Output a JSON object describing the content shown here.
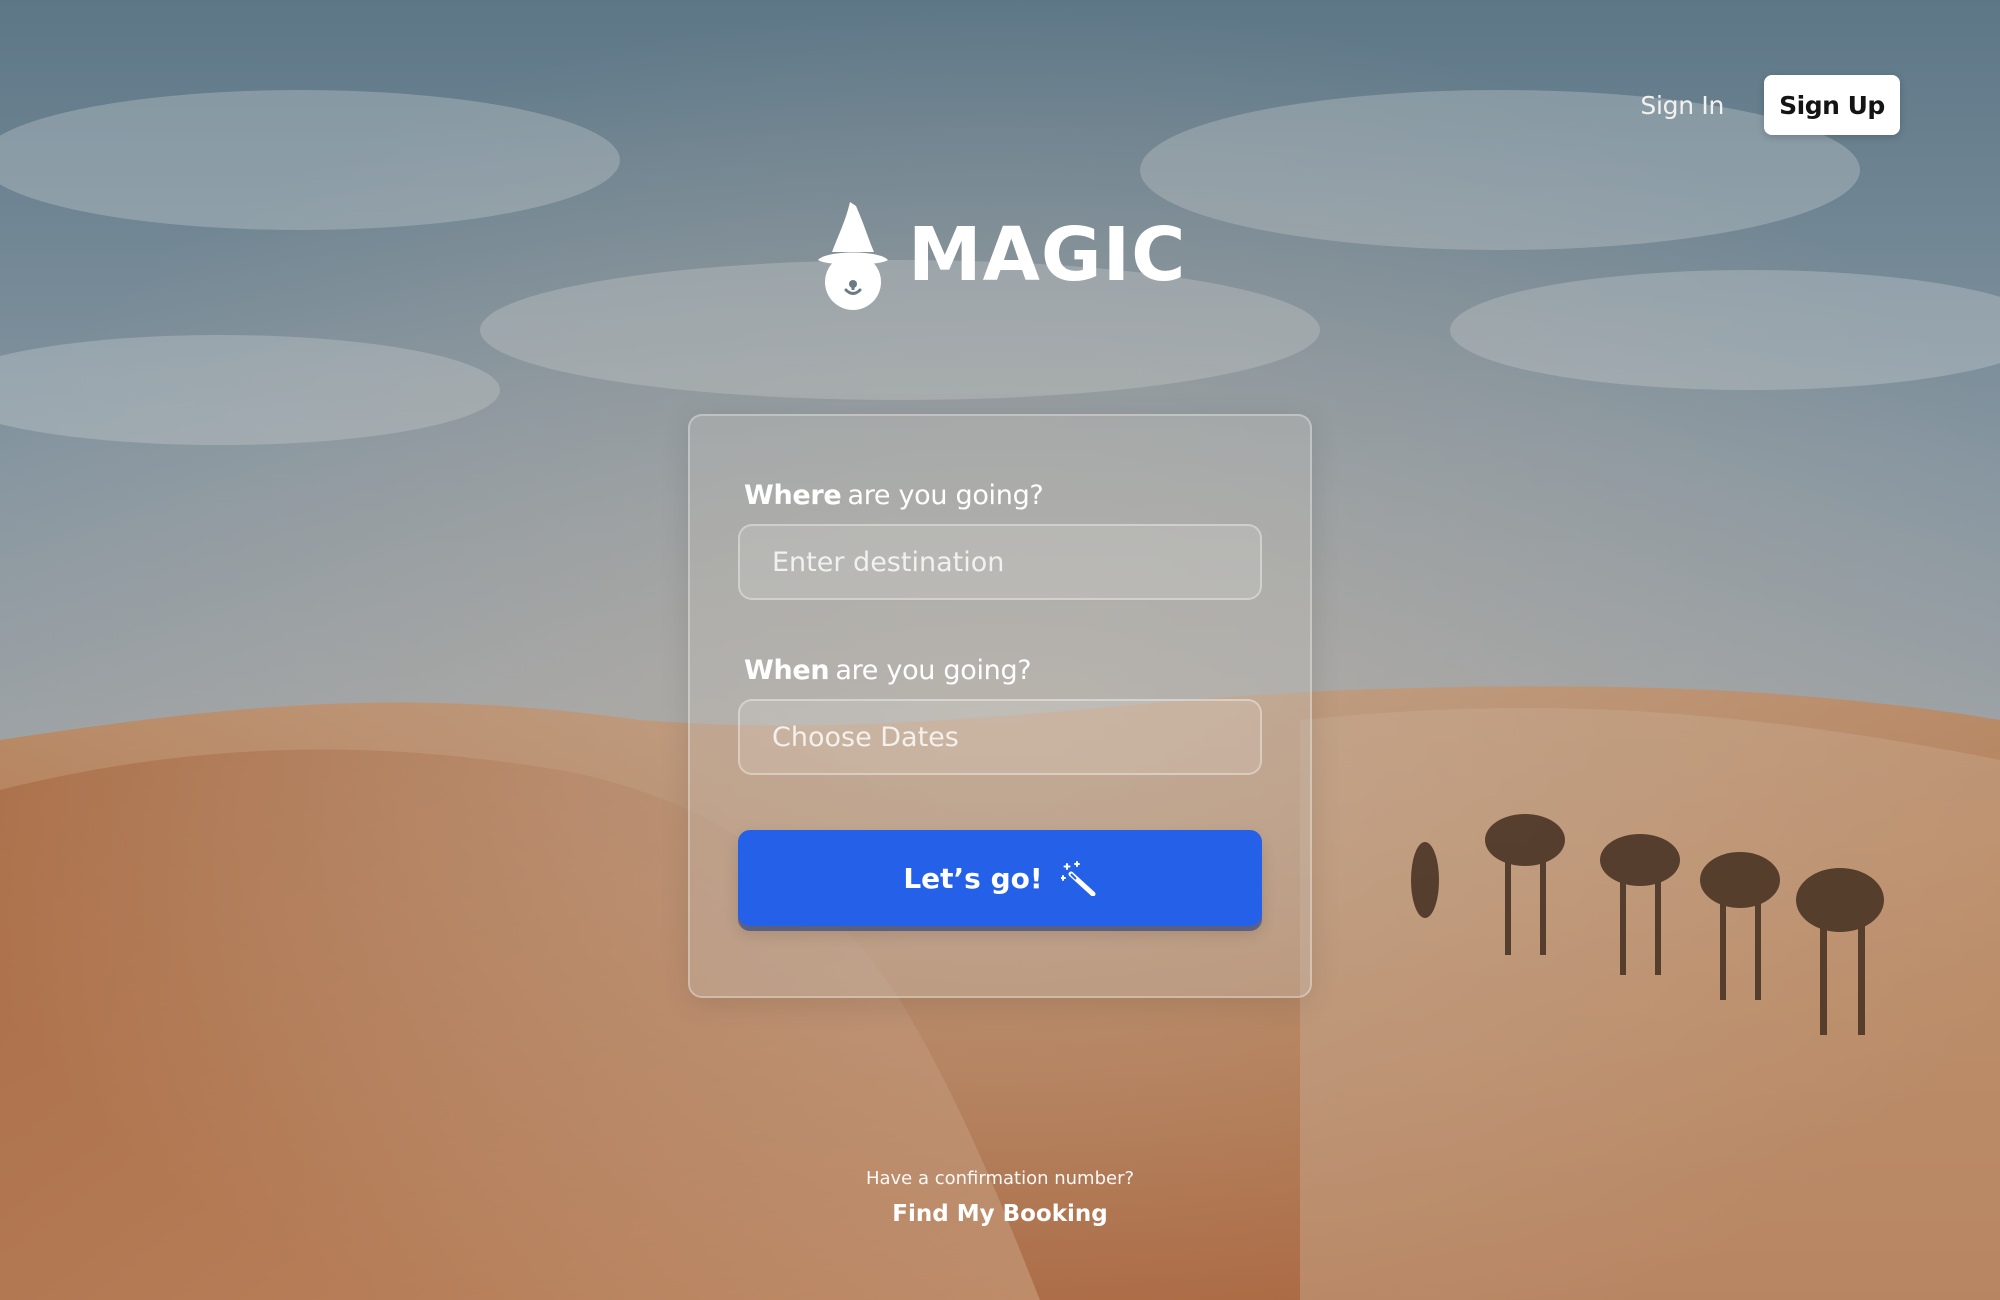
{
  "nav": {
    "sign_in": "Sign In",
    "sign_up": "Sign Up"
  },
  "brand": {
    "name": "MAGIC",
    "logo_icon": "wizard-hat-mascot-icon"
  },
  "form": {
    "destination": {
      "label_strong": "Where",
      "label_rest": "are you going?",
      "placeholder": "Enter destination"
    },
    "dates": {
      "label_strong": "When",
      "label_rest": "are you going?",
      "placeholder": "Choose Dates"
    },
    "submit": {
      "label": "Let’s go!",
      "icon": "magic-wand-icon"
    }
  },
  "footer": {
    "hint": "Have a confirmation number?",
    "link": "Find My Booking"
  },
  "colors": {
    "primary": "#2561e8",
    "text_on_image": "#ffffff",
    "sign_up_bg": "#ffffff"
  }
}
